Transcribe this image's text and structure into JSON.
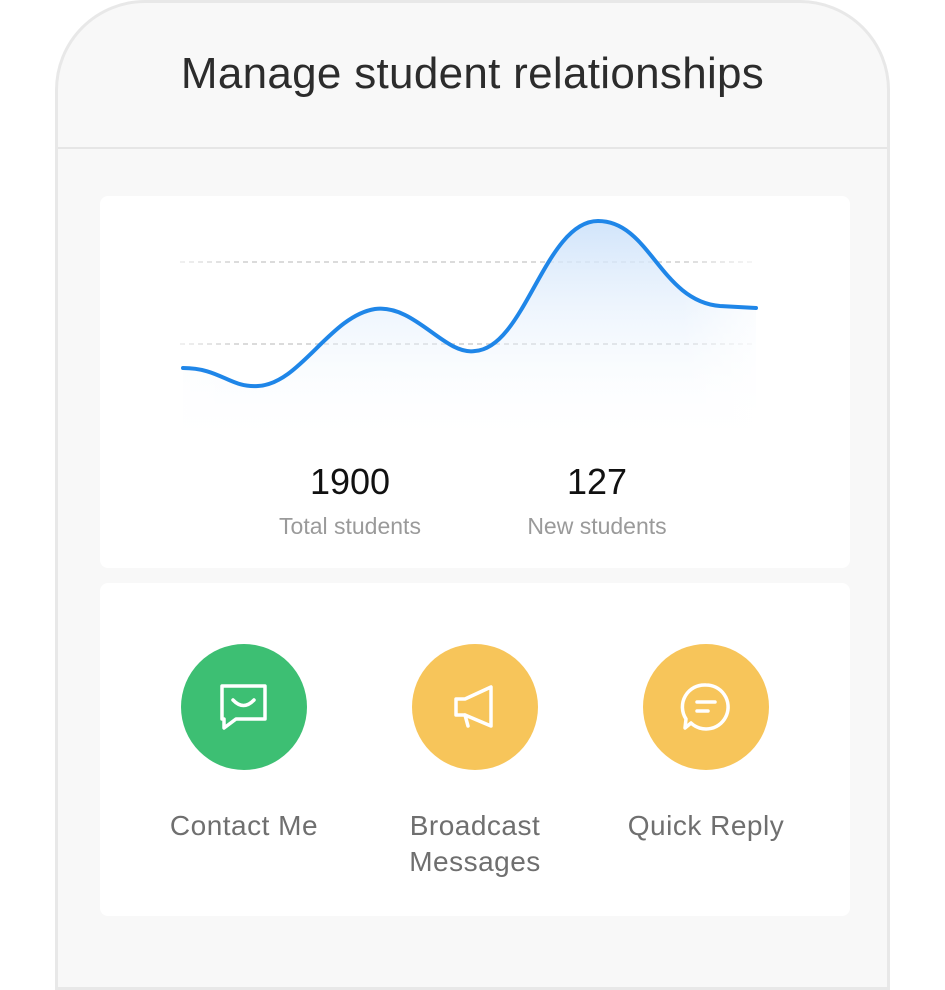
{
  "header": {
    "title": "Manage student relationships"
  },
  "stats": {
    "total": {
      "value": "1900",
      "label": "Total students"
    },
    "new": {
      "value": "127",
      "label": "New students"
    }
  },
  "actions": [
    {
      "label": "Contact Me",
      "icon": "chat-smile-icon",
      "color": "#3dbf73"
    },
    {
      "label": "Broadcast Messages",
      "icon": "megaphone-icon",
      "color": "#f7c55a"
    },
    {
      "label": "Quick Reply",
      "icon": "speech-bubble-icon",
      "color": "#f7c55a"
    }
  ],
  "colors": {
    "line": "#1f86e8",
    "fill": "#d6e8fb",
    "green": "#3dbf73",
    "yellow": "#f7c55a"
  }
}
